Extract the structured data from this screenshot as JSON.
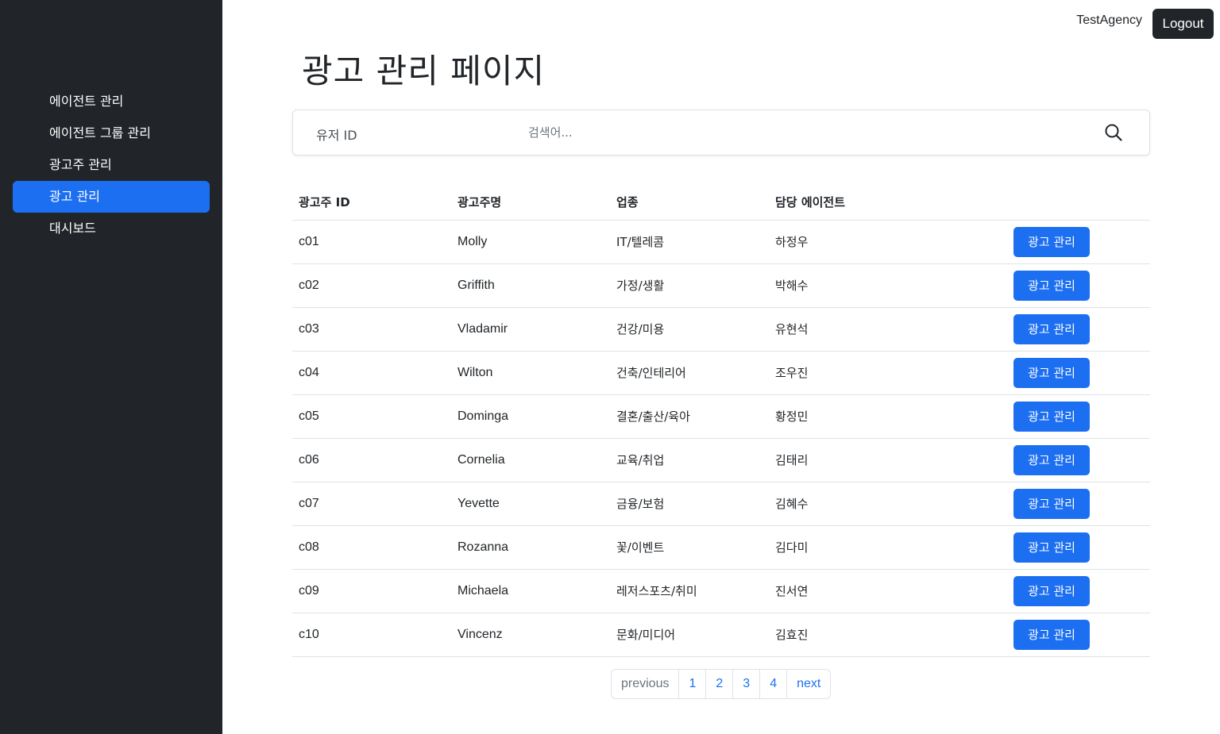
{
  "sidebar": {
    "items": [
      {
        "label": "에이전트 관리"
      },
      {
        "label": "에이전트 그룹 관리"
      },
      {
        "label": "광고주 관리"
      },
      {
        "label": "광고 관리"
      },
      {
        "label": "대시보드"
      }
    ],
    "active_index": 3
  },
  "header": {
    "user": "TestAgency",
    "logout_label": "Logout"
  },
  "page": {
    "title": "광고 관리 페이지"
  },
  "search": {
    "field_label": "유저 ID",
    "placeholder": "검색어...",
    "value": "",
    "icon": "search-icon"
  },
  "table": {
    "headers": [
      "광고주 ID",
      "광고주명",
      "업종",
      "담당 에이전트",
      ""
    ],
    "action_label": "광고 관리",
    "rows": [
      {
        "id": "c01",
        "name": "Molly",
        "industry": "IT/텔레콤",
        "agent": "하정우"
      },
      {
        "id": "c02",
        "name": "Griffith",
        "industry": "가정/생활",
        "agent": "박해수"
      },
      {
        "id": "c03",
        "name": "Vladamir",
        "industry": "건강/미용",
        "agent": "유현석"
      },
      {
        "id": "c04",
        "name": "Wilton",
        "industry": "건축/인테리어",
        "agent": "조우진"
      },
      {
        "id": "c05",
        "name": "Dominga",
        "industry": "결혼/출산/육아",
        "agent": "황정민"
      },
      {
        "id": "c06",
        "name": "Cornelia",
        "industry": "교육/취업",
        "agent": "김태리"
      },
      {
        "id": "c07",
        "name": "Yevette",
        "industry": "금융/보험",
        "agent": "김혜수"
      },
      {
        "id": "c08",
        "name": "Rozanna",
        "industry": "꽃/이벤트",
        "agent": "김다미"
      },
      {
        "id": "c09",
        "name": "Michaela",
        "industry": "레저스포츠/취미",
        "agent": "진서연"
      },
      {
        "id": "c10",
        "name": "Vincenz",
        "industry": "문화/미디어",
        "agent": "김효진"
      }
    ]
  },
  "pagination": {
    "previous": "previous",
    "pages": [
      "1",
      "2",
      "3",
      "4"
    ],
    "next": "next"
  },
  "colors": {
    "sidebar_bg": "#212529",
    "accent": "#1d6ff2",
    "logout_bg": "#212529"
  }
}
